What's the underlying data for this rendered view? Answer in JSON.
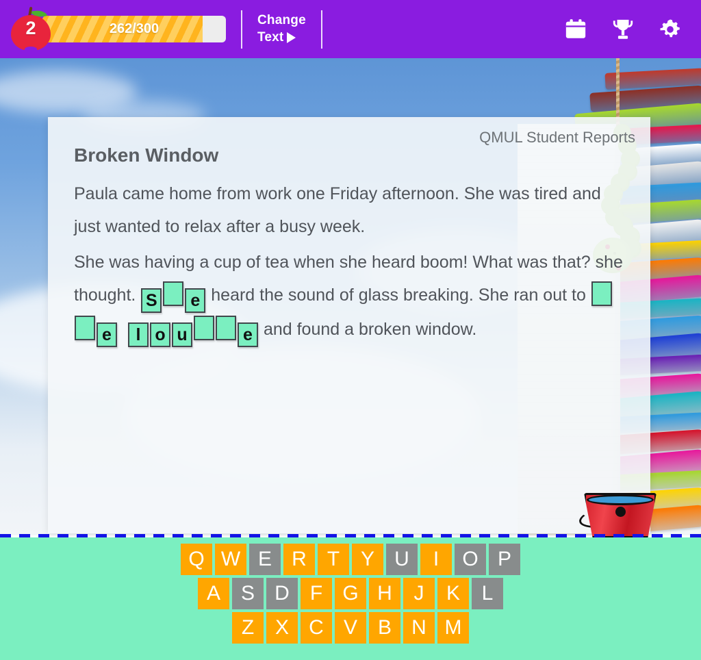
{
  "header": {
    "level_badge": "2",
    "progress_text": "262/300",
    "progress_current": 262,
    "progress_total": 300,
    "change_text_line1": "Change",
    "change_text_line2": "Text",
    "icons": [
      "calendar-icon",
      "trophy-icon",
      "gear-icon"
    ],
    "colors": {
      "bar_bg": "#8A1CE0",
      "progress_fill": "#FFB41E",
      "apple": "#E8243C"
    }
  },
  "card": {
    "watermark": "QMUL Student Reports",
    "title": "Broken Window",
    "paragraph1": "Paula came home from work one Friday afternoon. She was tired and just wanted to relax after a busy week.",
    "p2_part1": "She was having a cup of tea when she heard   boom!  What was that?  she thought. ",
    "p2_part2": " heard the sound of glass breaking. She ran out to ",
    "p2_part3": " and found a broken window.",
    "word1_boxes": [
      "S",
      "",
      "e"
    ],
    "word2_boxes": [
      "",
      "",
      "e"
    ],
    "word3_boxes": [
      "l",
      "o",
      "u",
      "",
      "",
      "e"
    ],
    "box_color": "#7BEFC0"
  },
  "keyboard": {
    "rows": [
      [
        {
          "label": "Q",
          "state": "used"
        },
        {
          "label": "W",
          "state": "used"
        },
        {
          "label": "E",
          "state": "dim"
        },
        {
          "label": "R",
          "state": "used"
        },
        {
          "label": "T",
          "state": "used"
        },
        {
          "label": "Y",
          "state": "used"
        },
        {
          "label": "U",
          "state": "dim"
        },
        {
          "label": "I",
          "state": "used"
        },
        {
          "label": "O",
          "state": "dim"
        },
        {
          "label": "P",
          "state": "dim"
        }
      ],
      [
        {
          "label": "A",
          "state": "used"
        },
        {
          "label": "S",
          "state": "dim"
        },
        {
          "label": "D",
          "state": "dim"
        },
        {
          "label": "F",
          "state": "used"
        },
        {
          "label": "G",
          "state": "used"
        },
        {
          "label": "H",
          "state": "used"
        },
        {
          "label": "J",
          "state": "used"
        },
        {
          "label": "K",
          "state": "used"
        },
        {
          "label": "L",
          "state": "dim"
        }
      ],
      [
        {
          "label": "Z",
          "state": "used"
        },
        {
          "label": "X",
          "state": "used"
        },
        {
          "label": "C",
          "state": "used"
        },
        {
          "label": "V",
          "state": "used"
        },
        {
          "label": "B",
          "state": "used"
        },
        {
          "label": "N",
          "state": "used"
        },
        {
          "label": "M",
          "state": "used"
        }
      ]
    ],
    "colors": {
      "background": "#7BEFC0",
      "key_active": "#FFA600",
      "key_disabled": "#888C8C"
    }
  },
  "decor": {
    "caterpillar": "caterpillar-graphic",
    "bucket": "bucket-graphic",
    "books": "book-stack-graphic"
  }
}
